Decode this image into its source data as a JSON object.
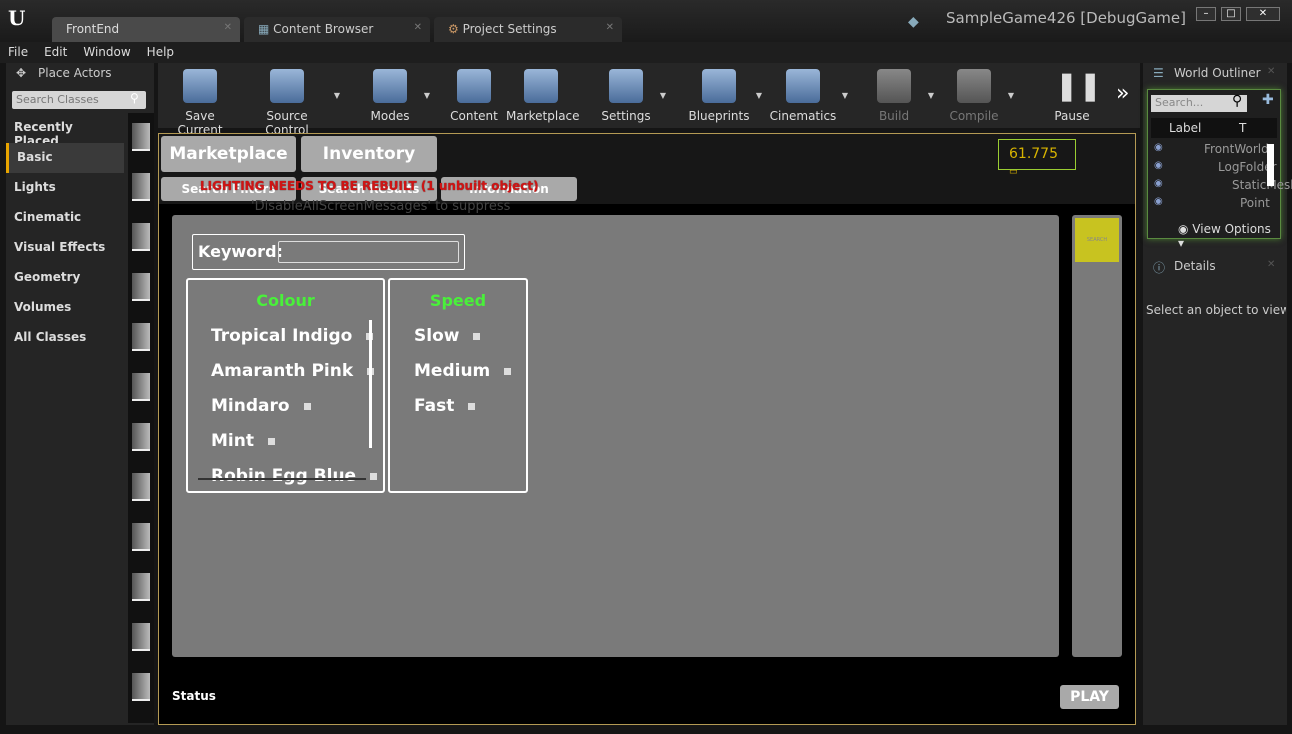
{
  "window": {
    "title": "SampleGame426 [DebugGame]",
    "tabs": [
      {
        "label": "FrontEnd"
      },
      {
        "label": "Content Browser"
      },
      {
        "label": "Project Settings"
      }
    ]
  },
  "menu": [
    "File",
    "Edit",
    "Window",
    "Help"
  ],
  "place_actors": {
    "title": "Place Actors",
    "search_placeholder": "Search Classes",
    "categories": [
      "Recently Placed",
      "Basic",
      "Lights",
      "Cinematic",
      "Visual Effects",
      "Geometry",
      "Volumes",
      "All Classes"
    ],
    "selected": "Basic"
  },
  "toolbar": [
    {
      "label": "Save Current",
      "icon": "save-icon"
    },
    {
      "label": "Source Control",
      "icon": "source-control-icon"
    },
    {
      "label": "Modes",
      "icon": "modes-icon"
    },
    {
      "label": "Content",
      "icon": "content-icon"
    },
    {
      "label": "Marketplace",
      "icon": "marketplace-icon"
    },
    {
      "label": "Settings",
      "icon": "settings-icon"
    },
    {
      "label": "Blueprints",
      "icon": "blueprints-icon"
    },
    {
      "label": "Cinematics",
      "icon": "cinematics-icon"
    },
    {
      "label": "Build",
      "icon": "build-icon"
    },
    {
      "label": "Compile",
      "icon": "compile-icon"
    },
    {
      "label": "Pause",
      "icon": "pause-icon"
    }
  ],
  "game": {
    "tabs": [
      "Marketplace",
      "Inventory"
    ],
    "subtabs": [
      "Search Filters",
      "Search Results",
      "Information"
    ],
    "warning": "LIGHTING NEEDS TO BE REBUILT (1 unbuilt object)",
    "warning_sub": "'DisableAllScreenMessages' to suppress",
    "fps": "61.775",
    "keyword_label": "Keyword:",
    "keyword_value": "",
    "colour": {
      "title": "Colour",
      "items": [
        "Tropical Indigo",
        "Amaranth Pink",
        "Mindaro",
        "Mint",
        "Robin Egg Blue"
      ]
    },
    "speed": {
      "title": "Speed",
      "items": [
        "Slow",
        "Medium",
        "Fast"
      ]
    },
    "search_button": "SEARCH",
    "status": "Status",
    "play": "PLAY",
    "accent_colors": {
      "filter_title": "#49f03a",
      "search_button": "#c8c320",
      "warning": "#d01414"
    }
  },
  "world_outliner": {
    "title": "World Outliner",
    "search_placeholder": "Search...",
    "columns": [
      "Label",
      "T"
    ],
    "rows": [
      "FrontWorld",
      "LogFolder",
      "StaticMesh",
      "Point"
    ],
    "view_options": "View Options"
  },
  "details": {
    "title": "Details",
    "empty": "Select an object to view d"
  }
}
